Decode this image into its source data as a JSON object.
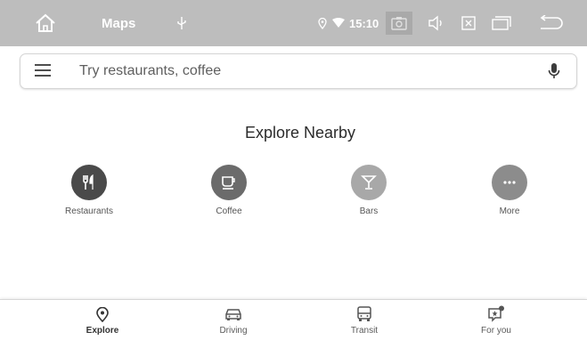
{
  "status_bar": {
    "app_title": "Maps",
    "time": "15:10",
    "icons": [
      "home-icon",
      "usb-icon",
      "location-icon",
      "wifi-icon",
      "screenshot-icon",
      "volume-icon",
      "close-icon",
      "recents-icon",
      "back-icon"
    ],
    "background_color": "#bdbdbd"
  },
  "search": {
    "placeholder": "Try restaurants, coffee",
    "value": "",
    "menu_icon": "menu-icon",
    "mic_icon": "mic-icon"
  },
  "explore": {
    "title": "Explore Nearby",
    "categories": [
      {
        "label": "Restaurants",
        "icon": "restaurant-icon",
        "color": "#4a4a4a"
      },
      {
        "label": "Coffee",
        "icon": "coffee-icon",
        "color": "#6b6b6b"
      },
      {
        "label": "Bars",
        "icon": "bar-icon",
        "color": "#a8a8a8"
      },
      {
        "label": "More",
        "icon": "more-icon",
        "color": "#8c8c8c"
      }
    ]
  },
  "bottom_nav": {
    "items": [
      {
        "label": "Explore",
        "icon": "explore-icon",
        "active": true
      },
      {
        "label": "Driving",
        "icon": "car-icon",
        "active": false
      },
      {
        "label": "Transit",
        "icon": "bus-icon",
        "active": false
      },
      {
        "label": "For you",
        "icon": "for-you-icon",
        "active": false
      }
    ]
  }
}
